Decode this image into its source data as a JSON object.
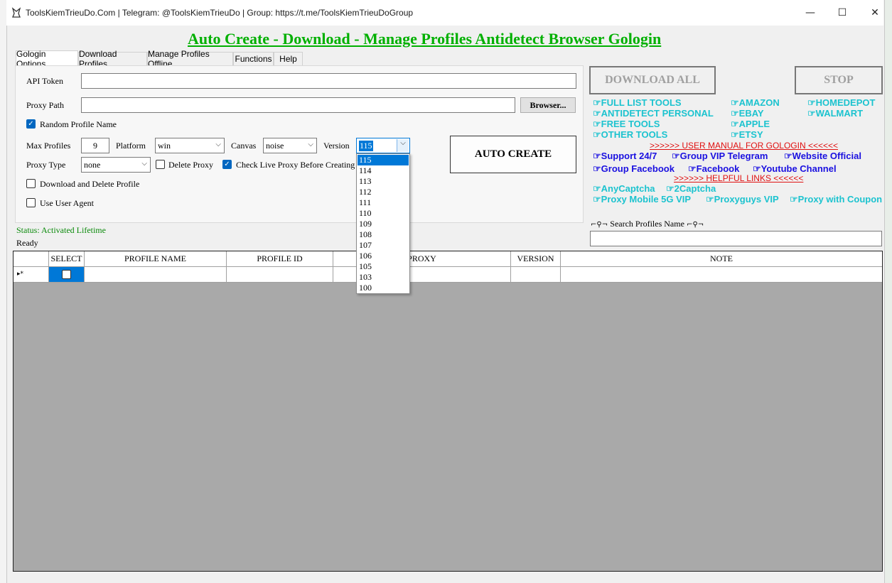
{
  "window": {
    "title": "ToolsKiemTrieuDo.Com | Telegram: @ToolsKiemTrieuDo | Group: https://t.me/ToolsKiemTrieuDoGroup",
    "heading": "Auto Create - Download - Manage Profiles Antidetect Browser Gologin",
    "controls": {
      "minimize": "—",
      "maximize": "☐",
      "close": "✕"
    }
  },
  "tabs": [
    "Gologin Options",
    "Download Profiles",
    "Manage Profiles Offline",
    "Functions",
    "Help"
  ],
  "form": {
    "api_token_label": "API Token",
    "api_token_value": "",
    "proxy_path_label": "Proxy Path",
    "proxy_path_value": "",
    "browse_button": "Browser...",
    "random_profile_name": "Random Profile Name",
    "max_profiles_label": "Max Profiles",
    "max_profiles_value": "9",
    "platform_label": "Platform",
    "platform_value": "win",
    "canvas_label": "Canvas",
    "canvas_value": "noise",
    "version_label": "Version",
    "version_value": "115",
    "proxy_type_label": "Proxy Type",
    "proxy_type_value": "none",
    "delete_proxy": "Delete Proxy",
    "check_live_proxy": "Check Live Proxy Before Creating P",
    "download_delete": "Download and Delete Profile",
    "use_user_agent": "Use User Agent",
    "auto_create": "AUTO CREATE"
  },
  "version_options": [
    "115",
    "114",
    "113",
    "112",
    "111",
    "110",
    "109",
    "108",
    "107",
    "106",
    "105",
    "103",
    "100"
  ],
  "status": {
    "activated": "Status: Activated Lifetime",
    "ready": "Ready"
  },
  "right": {
    "download_all": "DOWNLOAD ALL",
    "stop": "STOP",
    "links_col1": [
      "FULL LIST TOOLS",
      "ANTIDETECT PERSONAL",
      "FREE TOOLS",
      "OTHER TOOLS"
    ],
    "links_col2": [
      "AMAZON",
      "EBAY",
      "APPLE",
      "ETSY"
    ],
    "links_col3": [
      "HOMEDEPOT",
      "WALMART"
    ],
    "manual": ">>>>>> USER MANUAL FOR GOLOGIN <<<<<<",
    "support": [
      "Support 24/7",
      "Group VIP Telegram",
      "Website Official"
    ],
    "social": [
      "Group Facebook",
      "Facebook",
      "Youtube Channel"
    ],
    "helpful": ">>>>>> HELPFUL LINKS <<<<<<",
    "captcha": [
      "AnyCaptcha",
      "2Captcha"
    ],
    "proxies": [
      "Proxy Mobile 5G VIP",
      "Proxyguys VIP",
      "Proxy with Coupon"
    ],
    "search_label": "Search Profiles Name",
    "search_value": ""
  },
  "grid": {
    "columns": [
      "SELECT",
      "PROFILE NAME",
      "PROFILE ID",
      "PROXY",
      "VERSION",
      "NOTE"
    ],
    "row_marker": "▸*"
  },
  "colors": {
    "heading": "#00b000",
    "teal_links": "#1cc3cf",
    "blue_links": "#1a10e0",
    "red_links": "#e01010",
    "status": "#0a8a0a"
  }
}
